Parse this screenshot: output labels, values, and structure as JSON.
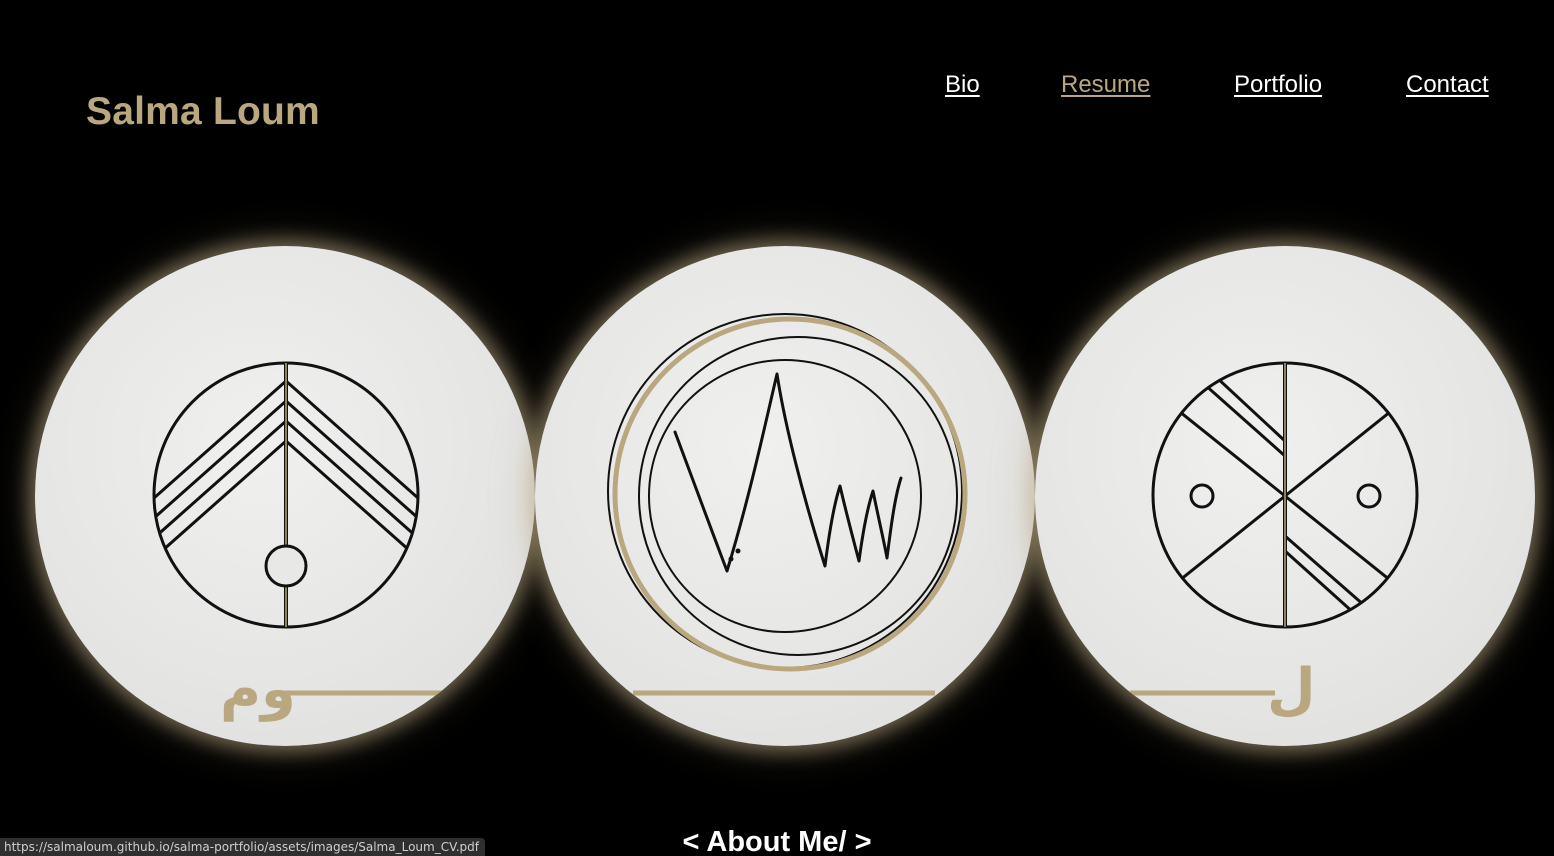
{
  "header": {
    "title": "Salma Loum"
  },
  "nav": {
    "items": [
      {
        "label": "Bio",
        "active": false
      },
      {
        "label": "Resume",
        "active": true
      },
      {
        "label": "Portfolio",
        "active": false
      },
      {
        "label": "Contact",
        "active": false
      }
    ]
  },
  "hero": {
    "discs": [
      {
        "icon": "chevron-symbol-icon",
        "calligraphy": "وم"
      },
      {
        "icon": "signature-logo-icon",
        "calligraphy": ""
      },
      {
        "icon": "cross-symbol-icon",
        "calligraphy": "ل"
      }
    ]
  },
  "footer": {
    "about_label": "< About Me/ >"
  },
  "status_bar": {
    "url": "https://salmaloum.github.io/salma-portfolio/assets/images/Salma_Loum_CV.pdf"
  },
  "colors": {
    "background": "#000000",
    "accent": "#b9a77f",
    "text": "#ffffff"
  }
}
